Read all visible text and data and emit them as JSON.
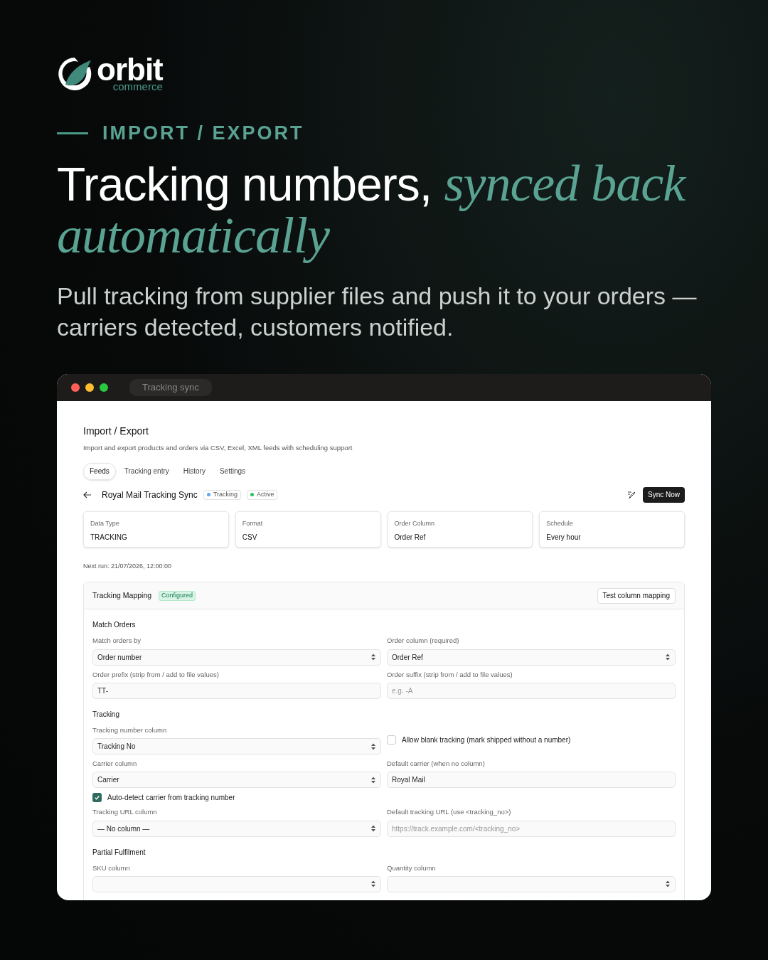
{
  "brand": {
    "name": "orbit",
    "tagline": "commerce"
  },
  "eyebrow": "IMPORT / EXPORT",
  "headline": "Tracking numbers, *synced back automatically*",
  "subhead": "Pull tracking from supplier files and push it to your orders — carriers detected, customers notified.",
  "window": {
    "title": "Tracking sync"
  },
  "page": {
    "title": "Import / Export",
    "description": "Import and export products and orders via CSV, Excel, XML feeds with scheduling support"
  },
  "tabs": [
    {
      "label": "Feeds",
      "selected": true
    },
    {
      "label": "Tracking entry",
      "selected": false
    },
    {
      "label": "History",
      "selected": false
    },
    {
      "label": "Settings",
      "selected": false
    }
  ],
  "feed": {
    "name": "Royal Mail Tracking Sync",
    "badges": [
      {
        "label": "Tracking",
        "color": "#60a5fa"
      },
      {
        "label": "Active",
        "color": "#22c55e"
      }
    ],
    "action": "Sync Now"
  },
  "summary": [
    {
      "label": "Data Type",
      "value": "TRACKING"
    },
    {
      "label": "Format",
      "value": "CSV"
    },
    {
      "label": "Order Column",
      "value": "Order Ref"
    },
    {
      "label": "Schedule",
      "value": "Every hour"
    }
  ],
  "next_run": "Next run: 21/07/2026, 12:00:00",
  "mapping": {
    "title": "Tracking Mapping",
    "status": "Configured",
    "action": "Test column mapping",
    "sections": [
      {
        "title": "Match Orders",
        "rows": [
          [
            {
              "kind": "select",
              "label": "Match orders by",
              "value": "Order number"
            },
            {
              "kind": "select",
              "label": "Order column (required)",
              "value": "Order Ref"
            }
          ],
          [
            {
              "kind": "input",
              "label": "Order prefix (strip from / add to file values)",
              "value": "TT-"
            },
            {
              "kind": "input",
              "label": "Order suffix (strip from / add to file values)",
              "placeholder": "e.g. -A"
            }
          ]
        ]
      },
      {
        "title": "Tracking",
        "rows": [
          [
            {
              "kind": "select",
              "label": "Tracking number column",
              "value": "Tracking No"
            },
            {
              "kind": "checkbox",
              "label": "Allow blank tracking (mark shipped without a number)",
              "checked": false
            }
          ],
          [
            {
              "kind": "select",
              "label": "Carrier column",
              "value": "Carrier"
            },
            {
              "kind": "input",
              "label": "Default carrier (when no column)",
              "value": "Royal Mail"
            }
          ],
          [
            {
              "kind": "checkbox",
              "label": "Auto-detect carrier from tracking number",
              "checked": true
            }
          ],
          [
            {
              "kind": "select",
              "label": "Tracking URL column",
              "value": "— No column —"
            },
            {
              "kind": "input",
              "label": "Default tracking URL (use <tracking_no>)",
              "placeholder": "https://track.example.com/<tracking_no>"
            }
          ]
        ]
      },
      {
        "title": "Partial Fulfilment",
        "rows": [
          [
            {
              "kind": "select",
              "label": "SKU column"
            },
            {
              "kind": "select",
              "label": "Quantity column"
            }
          ]
        ]
      }
    ]
  }
}
